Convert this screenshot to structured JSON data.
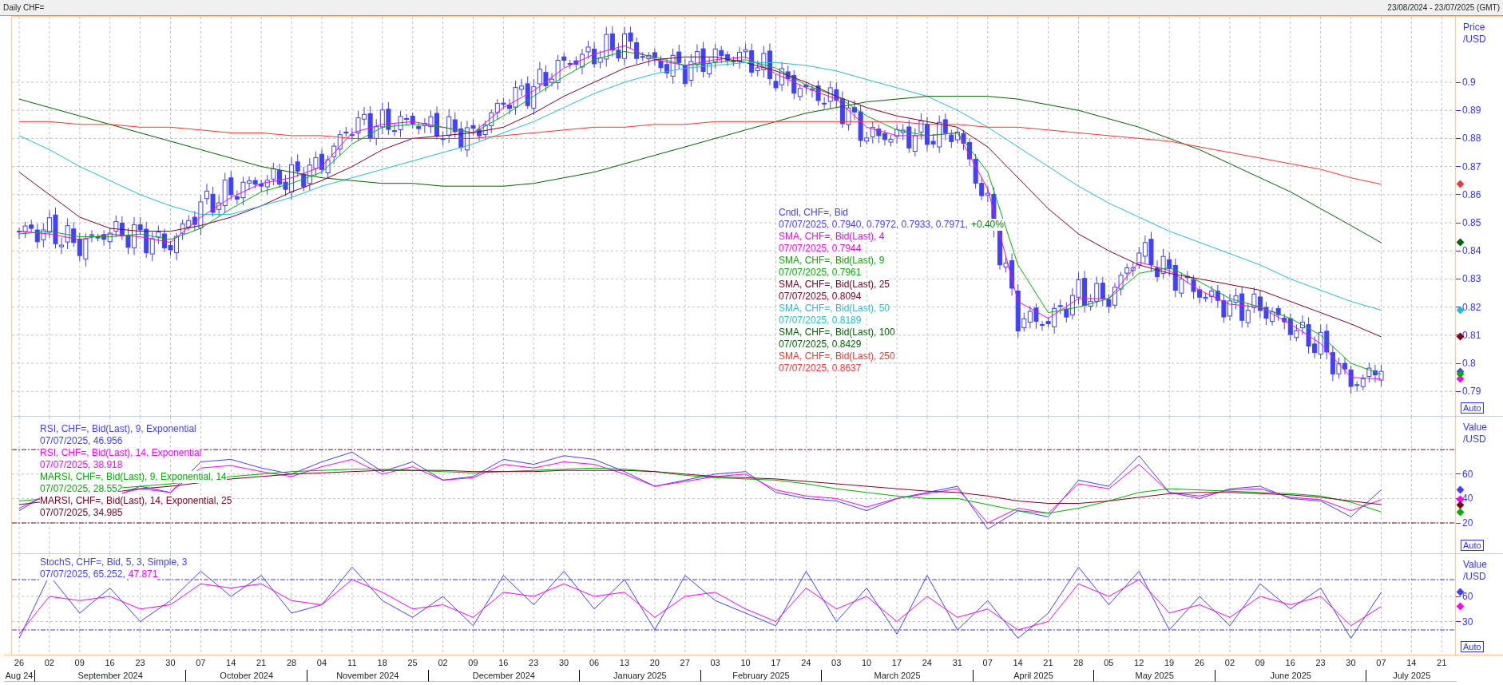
{
  "title_bar": {
    "title": "Daily CHF=",
    "range": "23/08/2024 - 23/07/2025 (GMT)"
  },
  "panels": [
    {
      "kind": "price",
      "axis_title": "Price /USD",
      "axis_labels": [
        "0.9",
        "0.89",
        "0.88",
        "0.87",
        "0.86",
        "0.85",
        "0.84",
        "0.83",
        "0.82",
        "0.81",
        "0.8",
        "0.79"
      ],
      "auto_button": "Auto",
      "legend": [
        {
          "name": "Cndl, CHF=, Bid",
          "color": "#4040ff",
          "reading": [
            {
              "text": "07/07/2025, 0.7940, 0.7972, 0.7933, 0.7971,",
              "color": "#4040ff"
            },
            {
              "text": "+0.40%",
              "color": "#008000"
            }
          ]
        },
        {
          "name": "SMA, CHF=, Bid(Last),  4",
          "color": "#ff00ff",
          "reading": [
            {
              "text": "07/07/2025, 0.7944",
              "color": "#ff00ff"
            }
          ]
        },
        {
          "name": "SMA, CHF=, Bid(Last),  9",
          "color": "#00b000",
          "reading": [
            {
              "text": "07/07/2025, 0.7961",
              "color": "#00b000"
            }
          ]
        },
        {
          "name": "SMA, CHF=, Bid(Last),  25",
          "color": "#800020",
          "reading": [
            {
              "text": "07/07/2025, 0.8094",
              "color": "#800020"
            }
          ]
        },
        {
          "name": "SMA, CHF=, Bid(Last),  50",
          "color": "#20c0d0",
          "reading": [
            {
              "text": "07/07/2025, 0.8189",
              "color": "#20c0d0"
            }
          ]
        },
        {
          "name": "SMA, CHF=, Bid(Last),  100",
          "color": "#006400",
          "reading": [
            {
              "text": "07/07/2025, 0.8429",
              "color": "#006400"
            }
          ]
        },
        {
          "name": "SMA, CHF=, Bid(Last),  250",
          "color": "#ff3333",
          "reading": [
            {
              "text": "07/07/2025, 0.8637",
              "color": "#ff3333"
            }
          ]
        }
      ]
    },
    {
      "kind": "rsi",
      "axis_title": "Value /USD",
      "axis_labels": [
        "60",
        "40",
        "20"
      ],
      "auto_button": "Auto",
      "legend": [
        {
          "name": "RSI, CHF=, Bid(Last),  9, Exponential",
          "color": "#4040ff",
          "reading": [
            {
              "text": "07/07/2025, 46.956",
              "color": "#4040ff"
            }
          ]
        },
        {
          "name": "RSI, CHF=, Bid(Last),  14, Exponential",
          "color": "#ff00ff",
          "reading": [
            {
              "text": "07/07/2025, 38.918",
              "color": "#ff00ff"
            }
          ]
        },
        {
          "name": "MARSI, CHF=, Bid(Last),  9, Exponential, 14",
          "color": "#00b000",
          "reading": [
            {
              "text": "07/07/2025, 28.552",
              "color": "#00b000"
            }
          ]
        },
        {
          "name": "MARSI, CHF=, Bid(Last),  14, Exponential, 25",
          "color": "#800020",
          "reading": [
            {
              "text": "07/07/2025, 34.985",
              "color": "#800020"
            }
          ]
        }
      ]
    },
    {
      "kind": "stoch",
      "axis_title": "Value /USD",
      "axis_labels": [
        "60",
        "30"
      ],
      "auto_button": "Auto",
      "legend": [
        {
          "name": "StochS, CHF=, Bid,  5, 3, Simple, 3",
          "color": "#4040ff",
          "reading": [
            {
              "text": "07/07/2025, 65.252,",
              "color": "#4040ff"
            },
            {
              "text": "47.871",
              "color": "#ff00ff"
            }
          ]
        }
      ]
    }
  ],
  "x_axis": {
    "months": [
      {
        "label": "Aug 24",
        "days": [
          "26"
        ]
      },
      {
        "label": "September 2024",
        "days": [
          "02",
          "09",
          "16",
          "23",
          "30"
        ]
      },
      {
        "label": "October 2024",
        "days": [
          "07",
          "14",
          "21",
          "28"
        ]
      },
      {
        "label": "November 2024",
        "days": [
          "04",
          "11",
          "18",
          "25"
        ]
      },
      {
        "label": "December 2024",
        "days": [
          "02",
          "09",
          "16",
          "23",
          "30"
        ]
      },
      {
        "label": "January 2025",
        "days": [
          "06",
          "13",
          "20",
          "27"
        ]
      },
      {
        "label": "February 2025",
        "days": [
          "03",
          "10",
          "17",
          "24"
        ]
      },
      {
        "label": "March 2025",
        "days": [
          "03",
          "10",
          "17",
          "24",
          "31"
        ]
      },
      {
        "label": "April 2025",
        "days": [
          "07",
          "14",
          "21",
          "28"
        ]
      },
      {
        "label": "May 2025",
        "days": [
          "05",
          "12",
          "19",
          "26"
        ]
      },
      {
        "label": "June 2025",
        "days": [
          "02",
          "09",
          "16",
          "23",
          "30"
        ]
      },
      {
        "label": "July 2025",
        "days": [
          "07",
          "14",
          "21"
        ]
      }
    ]
  }
}
